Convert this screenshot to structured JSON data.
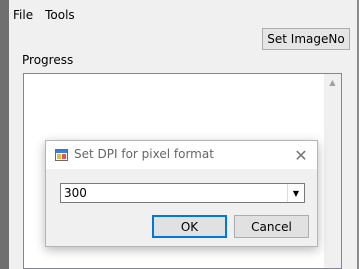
{
  "menubar": {
    "items": [
      "File",
      "Tools"
    ]
  },
  "toolbar": {
    "set_imageno_label": "Set ImageNo"
  },
  "progress": {
    "label": "Progress"
  },
  "dialog": {
    "title": "Set DPI for pixel format",
    "dpi_value": "300",
    "ok_label": "OK",
    "cancel_label": "Cancel"
  },
  "icons": {
    "dialog_icon": "app-window-icon",
    "close": "close-icon",
    "dropdown": "chevron-down-icon",
    "scroll_up": "scroll-up-arrow-icon"
  },
  "colors": {
    "accent": "#0078d7",
    "window_bg": "#f0f0f0"
  }
}
